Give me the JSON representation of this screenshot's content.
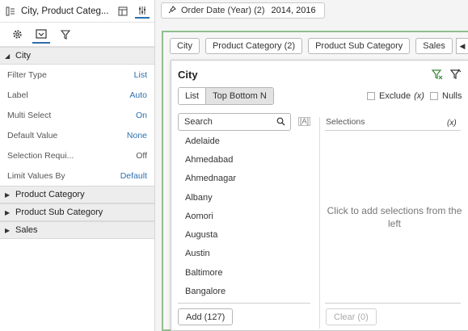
{
  "left_panel": {
    "title": "City, Product Categ...",
    "section_city": "City",
    "props": [
      {
        "label": "Filter Type",
        "value": "List"
      },
      {
        "label": "Label",
        "value": "Auto"
      },
      {
        "label": "Multi Select",
        "value": "On"
      },
      {
        "label": "Default Value",
        "value": "None"
      },
      {
        "label": "Selection Requi...",
        "value": "Off"
      },
      {
        "label": "Limit Values By",
        "value": "Default"
      }
    ],
    "sections": [
      "Product Category",
      "Product Sub Category",
      "Sales"
    ]
  },
  "topbar": {
    "filter_label": "Order Date (Year) (2)",
    "filter_value": "2014, 2016"
  },
  "chips": [
    "City",
    "Product Category (2)",
    "Product Sub Category",
    "Sales"
  ],
  "popup": {
    "title": "City",
    "seg_list": "List",
    "seg_topbottom": "Top Bottom N",
    "exclude_label": "Exclude",
    "exclude_x": "(x)",
    "nulls_label": "Nulls",
    "search_placeholder": "Search",
    "a_button": "[A]",
    "items": [
      "Adelaide",
      "Ahmedabad",
      "Ahmednagar",
      "Albany",
      "Aomori",
      "Augusta",
      "Austin",
      "Baltimore",
      "Bangalore"
    ],
    "add_label": "Add (127)",
    "selections_header": "Selections",
    "selections_x": "(x)",
    "selections_empty": "Click to add selections from the left",
    "clear_label": "Clear (0)"
  },
  "colors": {
    "accent": "#2d6fae",
    "canvas_border": "#8fbf8f"
  }
}
